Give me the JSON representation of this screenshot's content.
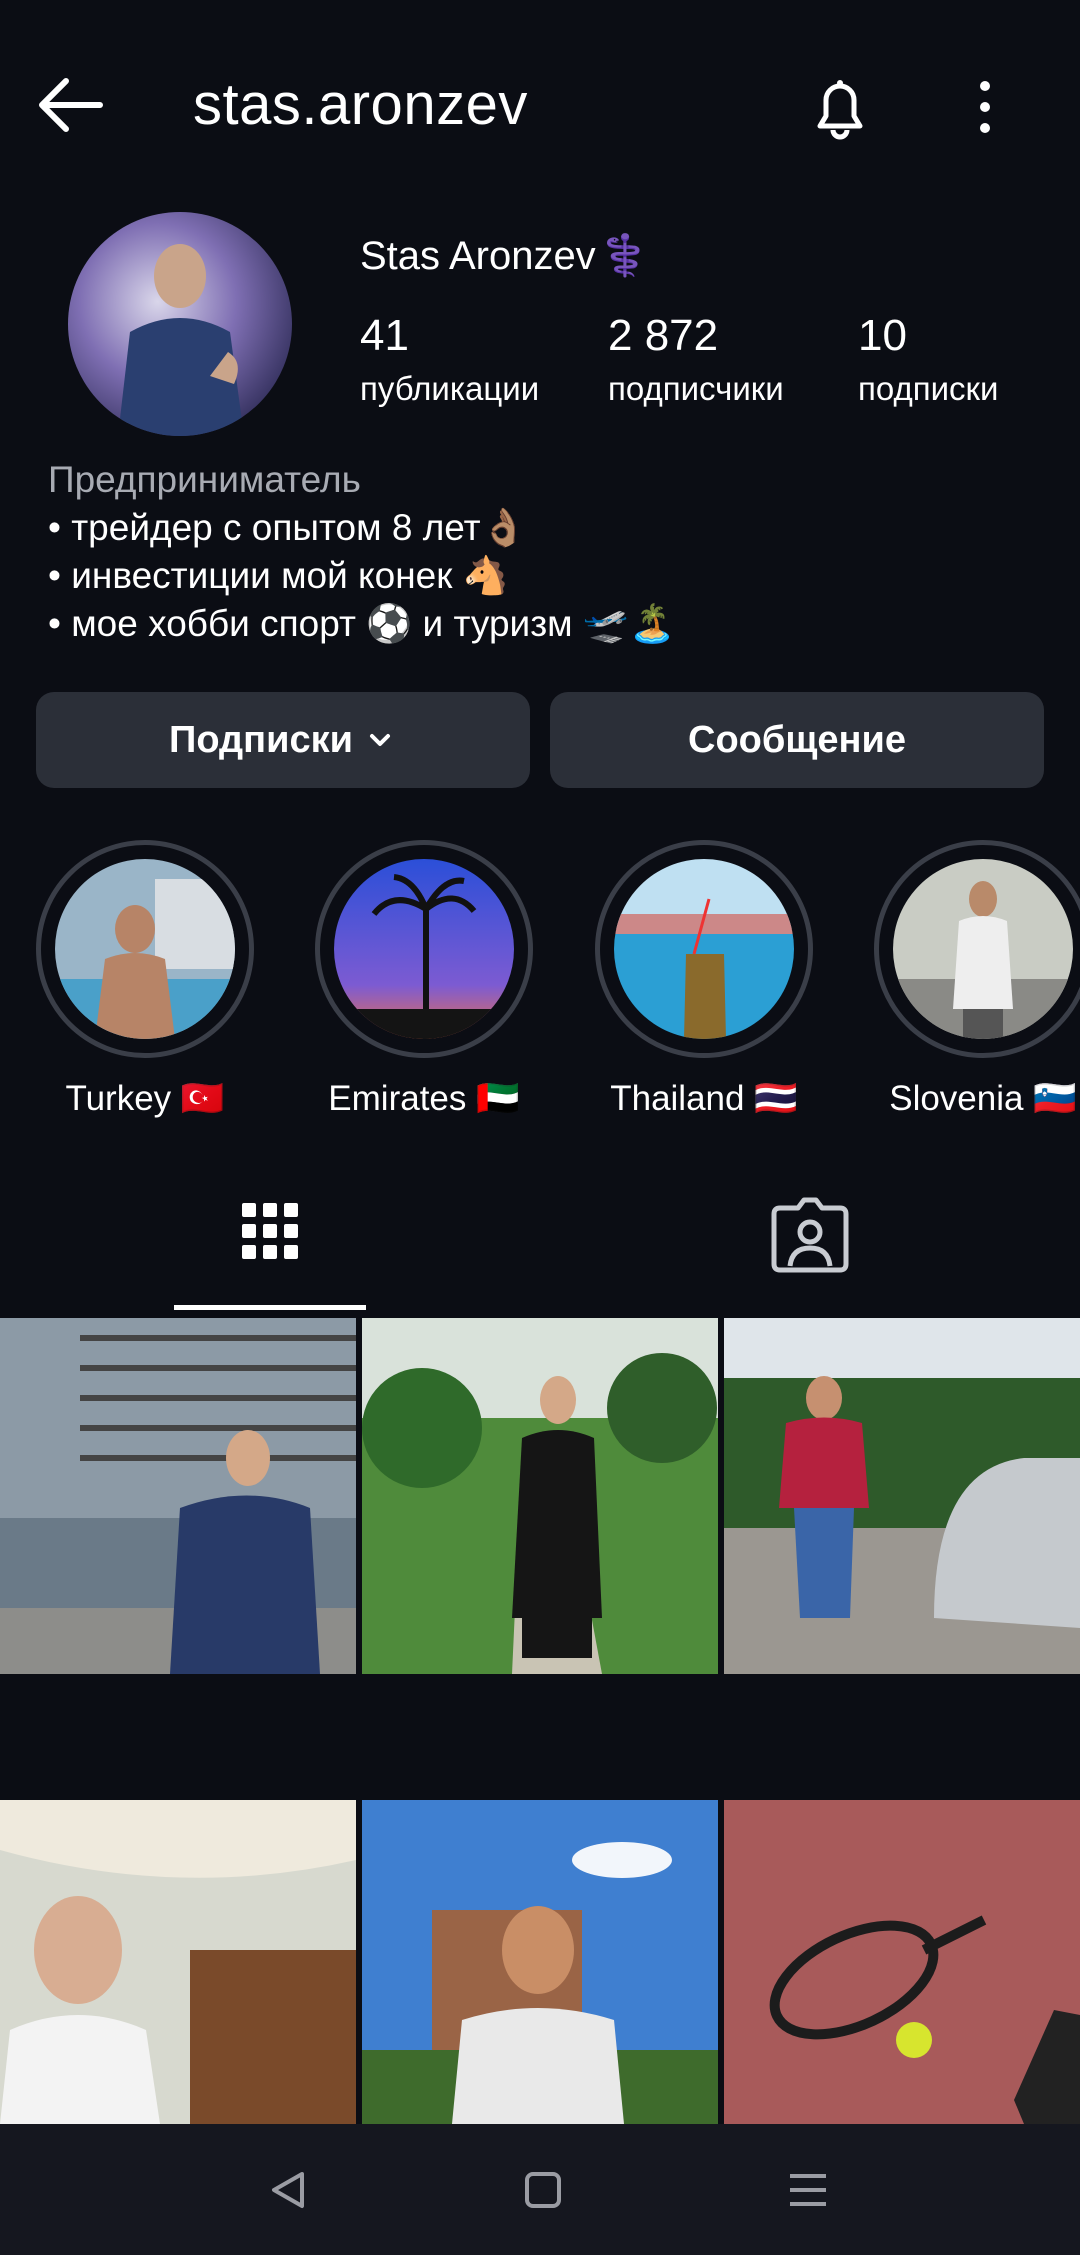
{
  "header": {
    "username": "stas.aronzev"
  },
  "profile": {
    "display_name": "Stas Aronzev",
    "badge": "⚕️",
    "stats": [
      {
        "value": "41",
        "label": "публикации"
      },
      {
        "value": "2 872",
        "label": "подписчики"
      },
      {
        "value": "10",
        "label": "подписки"
      }
    ],
    "category": "Предприниматель",
    "bio_lines": [
      "• трейдер с опытом 8 лет👌🏽",
      "• инвестиции мой конек 🐴",
      "• мое хобби спорт ⚽ и туризм 🛫🏝️"
    ]
  },
  "actions": {
    "following_label": "Подписки",
    "message_label": "Сообщение"
  },
  "highlights": [
    {
      "label": "Turkey 🇹🇷"
    },
    {
      "label": "Emirates 🇦🇪"
    },
    {
      "label": "Thailand 🇹🇭"
    },
    {
      "label": "Slovenia 🇸🇮"
    }
  ],
  "colors": {
    "background": "#0b0d14",
    "button": "#2b2f38",
    "badge": "#9b6cf0",
    "muted_text": "#a8abb3"
  }
}
